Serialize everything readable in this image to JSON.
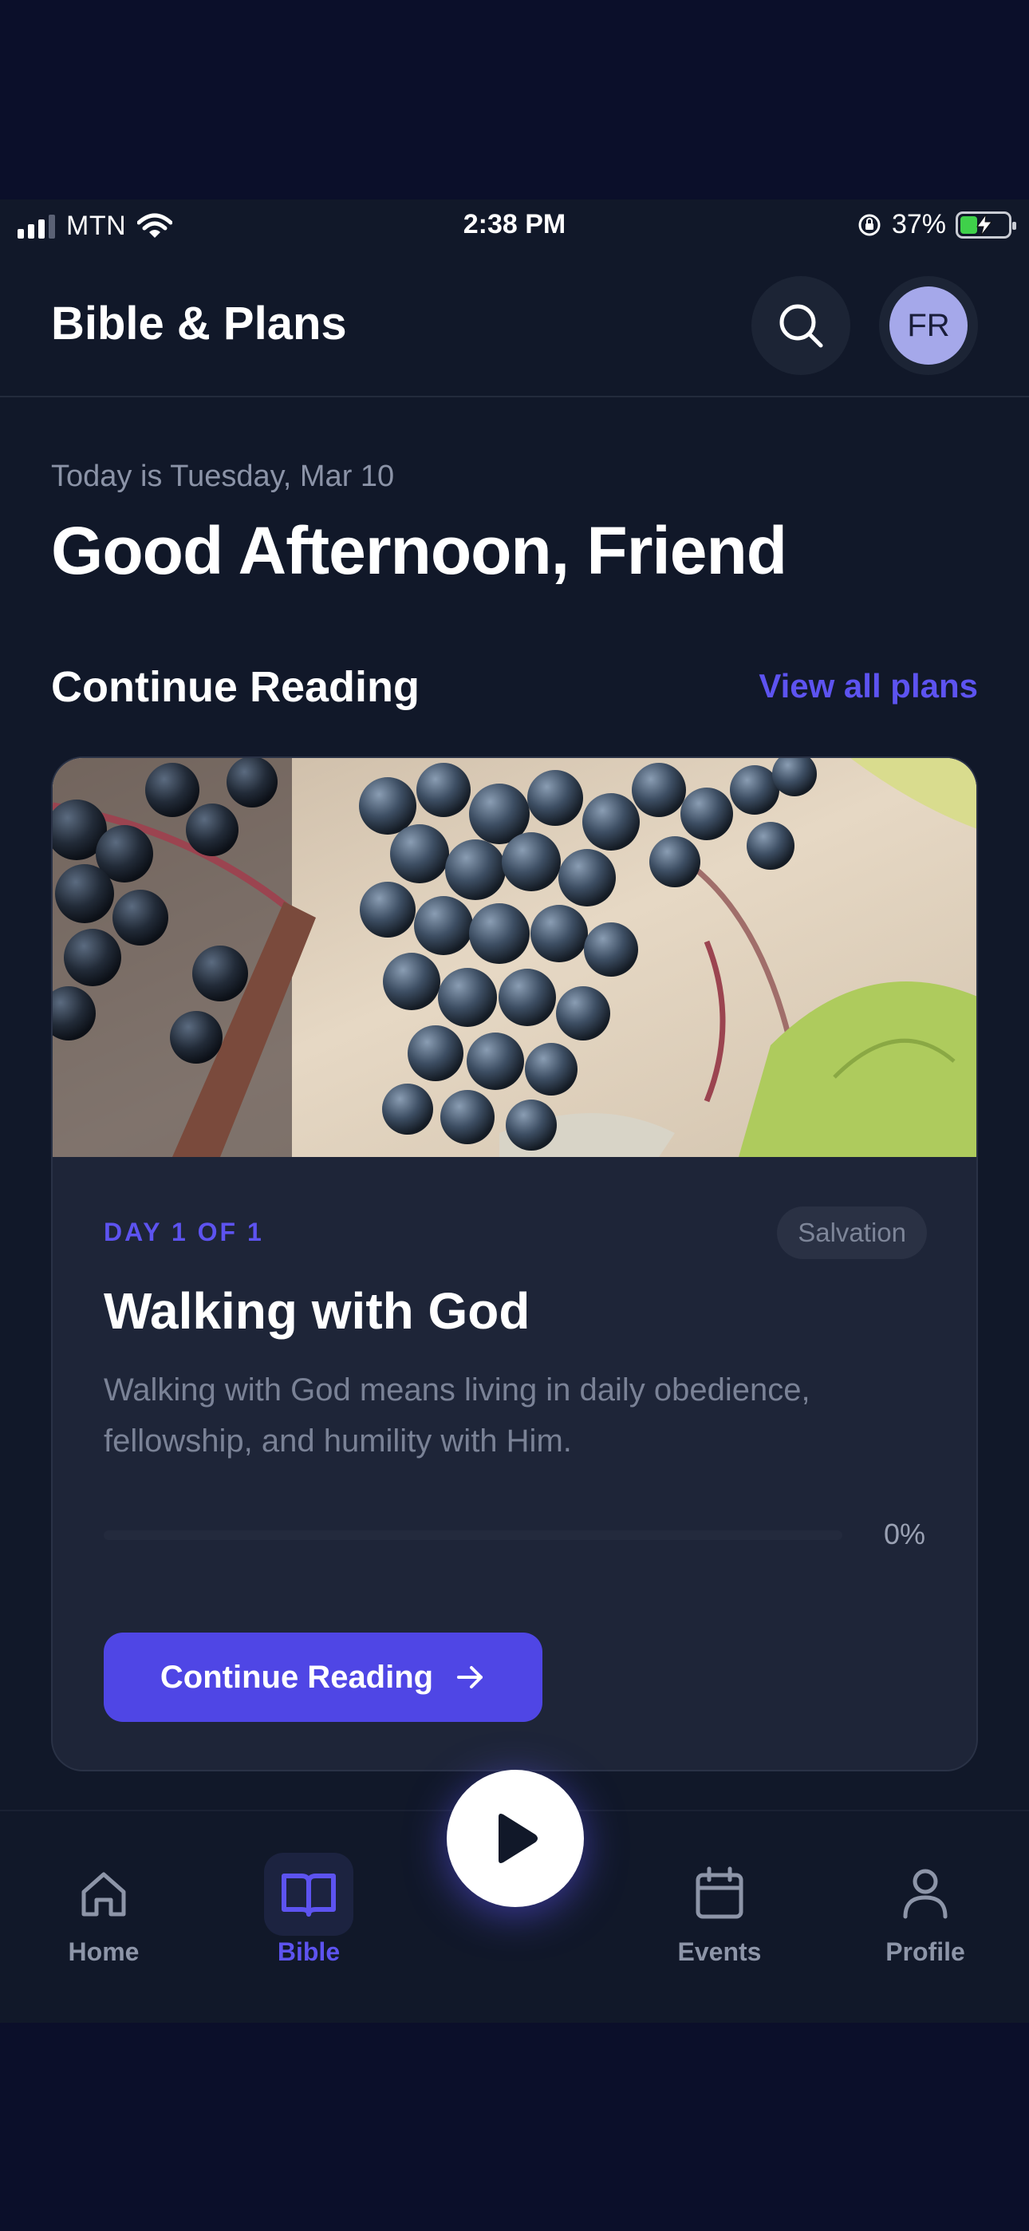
{
  "status_bar": {
    "carrier": "MTN",
    "time": "2:38 PM",
    "battery": "37%",
    "battery_level": 0.37,
    "icons": [
      "signal-icon",
      "wifi-icon",
      "orientation-lock-icon",
      "battery-charging-icon"
    ]
  },
  "header": {
    "title": "Bible & Plans",
    "avatar_initials": "FR",
    "search_icon": "search-icon"
  },
  "greeting": {
    "date": "Today is Tuesday, Mar 10",
    "message": "Good Afternoon, Friend"
  },
  "continue_reading": {
    "section_title": "Continue Reading",
    "view_all": "View all plans",
    "card": {
      "day": "DAY 1 OF 1",
      "tag": "Salvation",
      "title": "Walking with God",
      "description": "Walking with God means living in daily obedience, fellowship, and humility with Him.",
      "progress_label": "0%",
      "progress": 0,
      "button_label": "Continue Reading",
      "button_icon": "arrow-right-icon"
    }
  },
  "bottom_nav": {
    "items": [
      {
        "label": "Home",
        "icon": "home-icon"
      },
      {
        "label": "Bible",
        "icon": "book-icon",
        "active": true
      },
      {
        "label": "Events",
        "icon": "calendar-icon"
      },
      {
        "label": "Profile",
        "icon": "user-icon"
      }
    ],
    "center_icon": "play-icon"
  },
  "colors": {
    "background": "#111829",
    "outer": "#0b0f2a",
    "card": "#1e2538",
    "accent": "#5d53f0",
    "button": "#4f46e5",
    "avatar": "#a5a8ea"
  }
}
